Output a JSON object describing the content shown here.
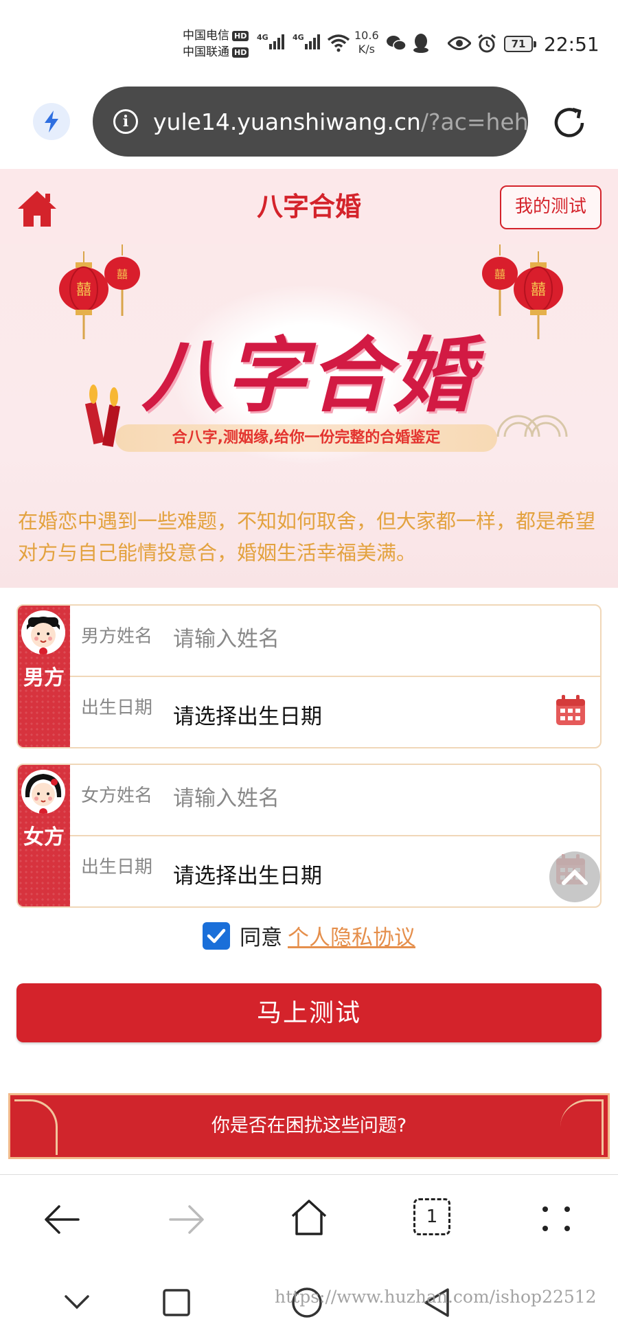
{
  "status_bar": {
    "carrier1": "中国电信",
    "carrier2": "中国联通",
    "hd_badge": "HD",
    "network1": "4G",
    "network2": "4G",
    "speed_value": "10.6",
    "speed_unit": "K/s",
    "battery": "71",
    "time": "22:51"
  },
  "browser": {
    "url_host": "yule14.yuanshiwang.cn",
    "url_rest": "/?ac=hehun"
  },
  "header": {
    "title": "八字合婚",
    "my_test": "我的测试"
  },
  "banner": {
    "big_title": "八字合婚",
    "ribbon": "合八字,测姻缘,给你一份完整的合婚鉴定",
    "intro": "在婚恋中遇到一些难题，不知如何取舍，但大家都一样，都是希望对方与自己能情投意合，婚姻生活幸福美满。"
  },
  "male_form": {
    "side_label": "男方",
    "name_label": "男方姓名",
    "name_placeholder": "请输入姓名",
    "date_label": "出生日期",
    "date_value": "请选择出生日期"
  },
  "female_form": {
    "side_label": "女方",
    "name_label": "女方姓名",
    "name_placeholder": "请输入姓名",
    "date_label": "出生日期",
    "date_value": "请选择出生日期"
  },
  "agreement": {
    "prefix": "同意",
    "link": "个人隐私协议",
    "checked": true
  },
  "submit_label": "马上测试",
  "troubles_banner": "你是否在困扰这些问题?",
  "browser_nav": {
    "tabs_count": "1"
  },
  "watermark": "https://www.huzhan.com/ishop22512",
  "colors": {
    "brand_red": "#d4232b",
    "intro_gold": "#e3a23f",
    "link_orange": "#e58f4c",
    "checkbox_blue": "#1a6fd9"
  }
}
